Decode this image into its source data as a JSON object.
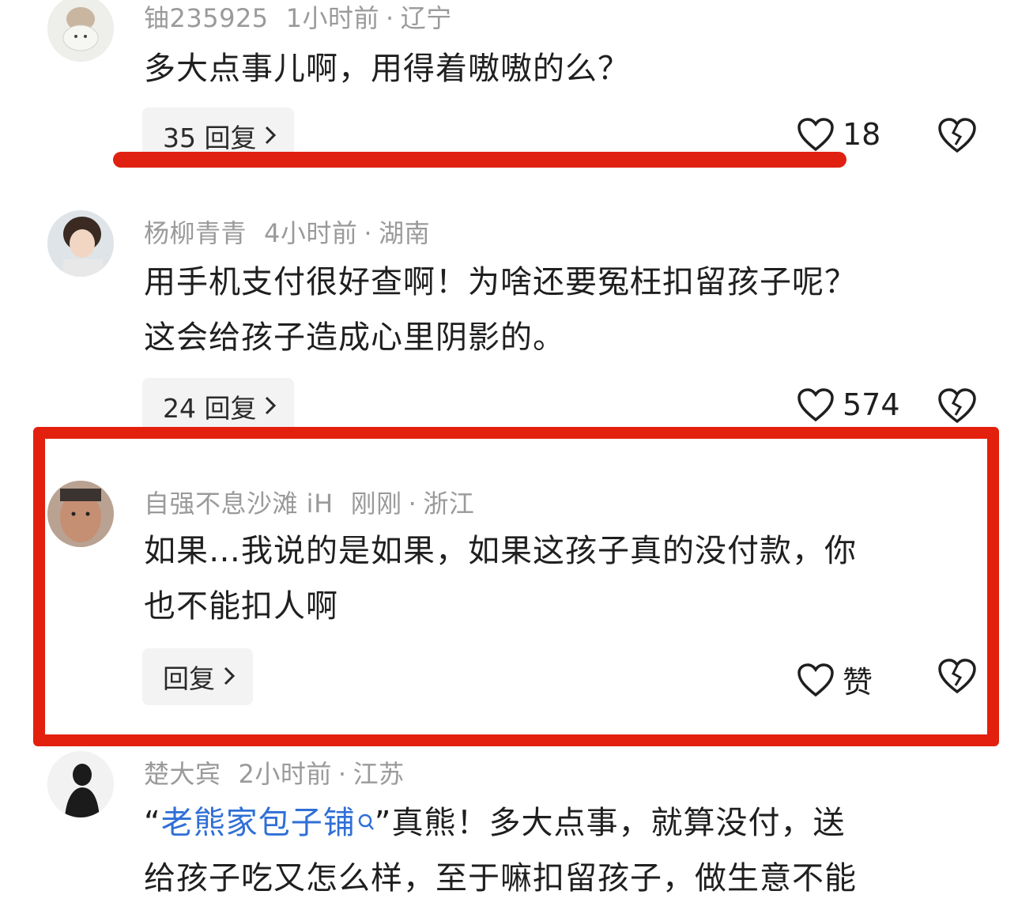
{
  "comments": [
    {
      "user": "铀235925",
      "time": "1小时前",
      "location": "辽宁",
      "text": "多大点事儿啊，用得着嗷嗷的么？",
      "reply_label": "35 回复",
      "likes": "18"
    },
    {
      "user": "杨柳青青",
      "time": "4小时前",
      "location": "湖南",
      "text_line1": "用手机支付很好查啊！为啥还要冤枉扣留孩子呢？",
      "text_line2": "这会给孩子造成心里阴影的。",
      "reply_label": "24 回复",
      "likes": "574"
    },
    {
      "user": "自强不息沙滩 iH",
      "time": "刚刚",
      "location": "浙江",
      "text_line1": "如果…我说的是如果，如果这孩子真的没付款，你",
      "text_line2": "也不能扣人啊",
      "reply_label": "回复",
      "likes": "赞"
    },
    {
      "user": "楚大宾",
      "time": "2小时前",
      "location": "江苏",
      "quote_open": "“",
      "link_text": "老熊家包子铺",
      "quote_close": "”",
      "text_rest": "真熊！多大点事，就算没付，送",
      "text_line2": "给孩子吃又怎么样，至于嘛扣留孩子，做生意不能"
    }
  ],
  "separator": "·",
  "colors": {
    "annotation_red": "#e3200e",
    "meta_gray": "#9a9a9a",
    "link_blue": "#2f6fd6"
  }
}
